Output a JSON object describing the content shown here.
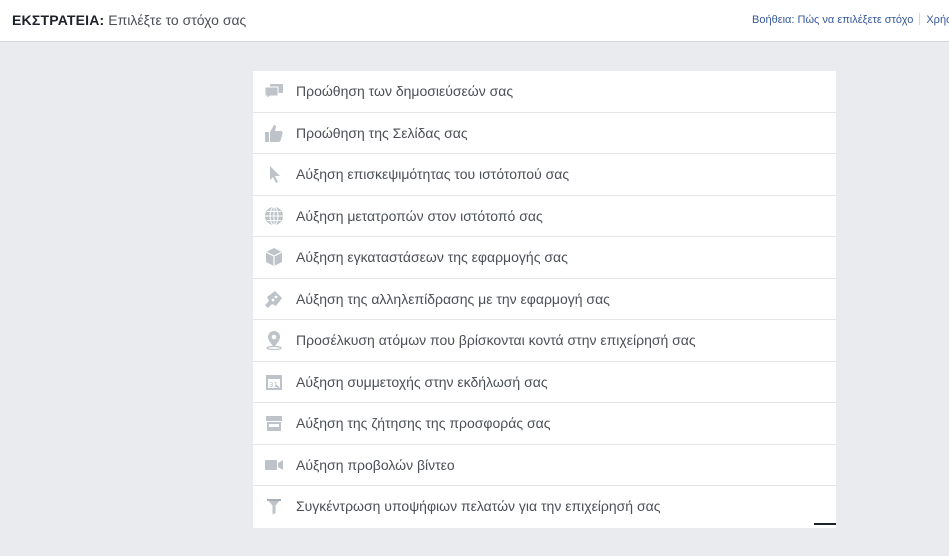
{
  "header": {
    "campaign_label": "ΕΚΣΤΡΑΤΕΙΑ:",
    "subtitle": "Επιλέξτε το στόχο σας",
    "help_link": "Βοήθεια: Πώς να επιλέξετε στόχο",
    "user_link": "Χρήσ"
  },
  "objectives": [
    {
      "label": "Προώθηση των δημοσιεύσεών σας",
      "icon": "chat-bubbles-icon"
    },
    {
      "label": "Προώθηση της Σελίδας σας",
      "icon": "thumbs-up-icon"
    },
    {
      "label": "Αύξηση επισκεψιμότητας του ιστότοπού σας",
      "icon": "cursor-icon"
    },
    {
      "label": "Αύξηση μετατροπών στον ιστότοπό σας",
      "icon": "globe-icon"
    },
    {
      "label": "Αύξηση εγκαταστάσεων της εφαρμογής σας",
      "icon": "cube-icon"
    },
    {
      "label": "Αύξηση της αλληλεπίδρασης με την εφαρμογή σας",
      "icon": "gamepad-icon"
    },
    {
      "label": "Προσέλκυση ατόμων που βρίσκονται κοντά στην επιχείρησή σας",
      "icon": "location-pin-icon"
    },
    {
      "label": "Αύξηση συμμετοχής στην εκδήλωσή σας",
      "icon": "calendar-icon"
    },
    {
      "label": "Αύξηση της ζήτησης της προσφοράς σας",
      "icon": "storefront-icon"
    },
    {
      "label": "Αύξηση προβολών βίντεο",
      "icon": "video-camera-icon"
    },
    {
      "label": "Συγκέντρωση υποψήφιων πελατών για την επιχείρησή σας",
      "icon": "funnel-icon"
    }
  ],
  "colors": {
    "icon": "#bec3c9",
    "text": "#4b4f56",
    "link": "#365899",
    "background": "#e9ebee"
  }
}
